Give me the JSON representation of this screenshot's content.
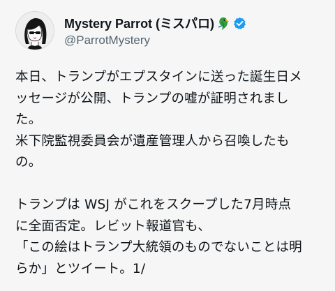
{
  "author": {
    "display_name": "Mystery Parrot (ミスパロ)",
    "handle": "@ParrotMystery",
    "avatar_icon": "woman-silhouette-avatar",
    "name_emoji": "parrot-icon",
    "verified_badge": "verified-icon",
    "verified_color": "#1d9bf0"
  },
  "tweet": {
    "lines": [
      "本日、トランプがエプスタインに送った誕生日メ",
      "ッセージが公開、トランプの嘘が証明されまし",
      "た。",
      "米下院監視委員会が遺産管理人から召喚したも",
      "の。",
      "",
      "トランプは WSJ がこれをスクープした7月時点",
      "に全面否定。レビット報道官も、",
      "「この絵はトランプ大統領のものでないことは明",
      "らか」とツイート。1/"
    ]
  }
}
